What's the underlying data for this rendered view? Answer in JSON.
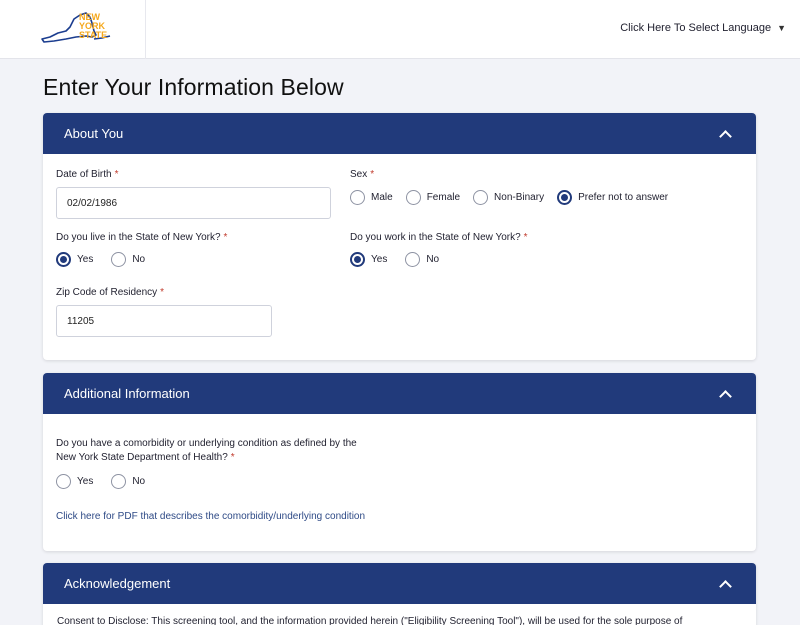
{
  "header": {
    "logo_lines": [
      "NEW",
      "YORK",
      "STATE"
    ],
    "language_label": "Click Here To Select Language"
  },
  "page_title": "Enter Your Information Below",
  "about_you": {
    "title": "About You",
    "dob_label": "Date of Birth",
    "dob_value": "02/02/1986",
    "sex_label": "Sex",
    "sex_options": [
      "Male",
      "Female",
      "Non-Binary",
      "Prefer not to answer"
    ],
    "sex_selected": "Prefer not to answer",
    "live_ny_label": "Do you live in the State of New York?",
    "live_ny_options": [
      "Yes",
      "No"
    ],
    "live_ny_selected": "Yes",
    "work_ny_label": "Do you work in the State of New York?",
    "work_ny_options": [
      "Yes",
      "No"
    ],
    "work_ny_selected": "Yes",
    "zip_label": "Zip Code of Residency",
    "zip_value": "11205"
  },
  "additional": {
    "title": "Additional Information",
    "question_line1": "Do you have a comorbidity or underlying condition as defined by the",
    "question_line2": "New York State Department of Health?",
    "options": [
      "Yes",
      "No"
    ],
    "selected": "",
    "pdf_link": "Click here for PDF that describes the comorbidity/underlying condition"
  },
  "acknowledgement": {
    "title": "Acknowledgement",
    "text": "Consent to Disclose: This screening tool, and the information provided herein (\"Eligibility Screening Tool\"), will be used for the sole purpose of"
  },
  "required_marker": "*",
  "colors": {
    "brand_navy": "#213a7b",
    "logo_gold": "#f5a81c",
    "logo_blue": "#1b3d8f",
    "required_red": "#c0392b"
  }
}
